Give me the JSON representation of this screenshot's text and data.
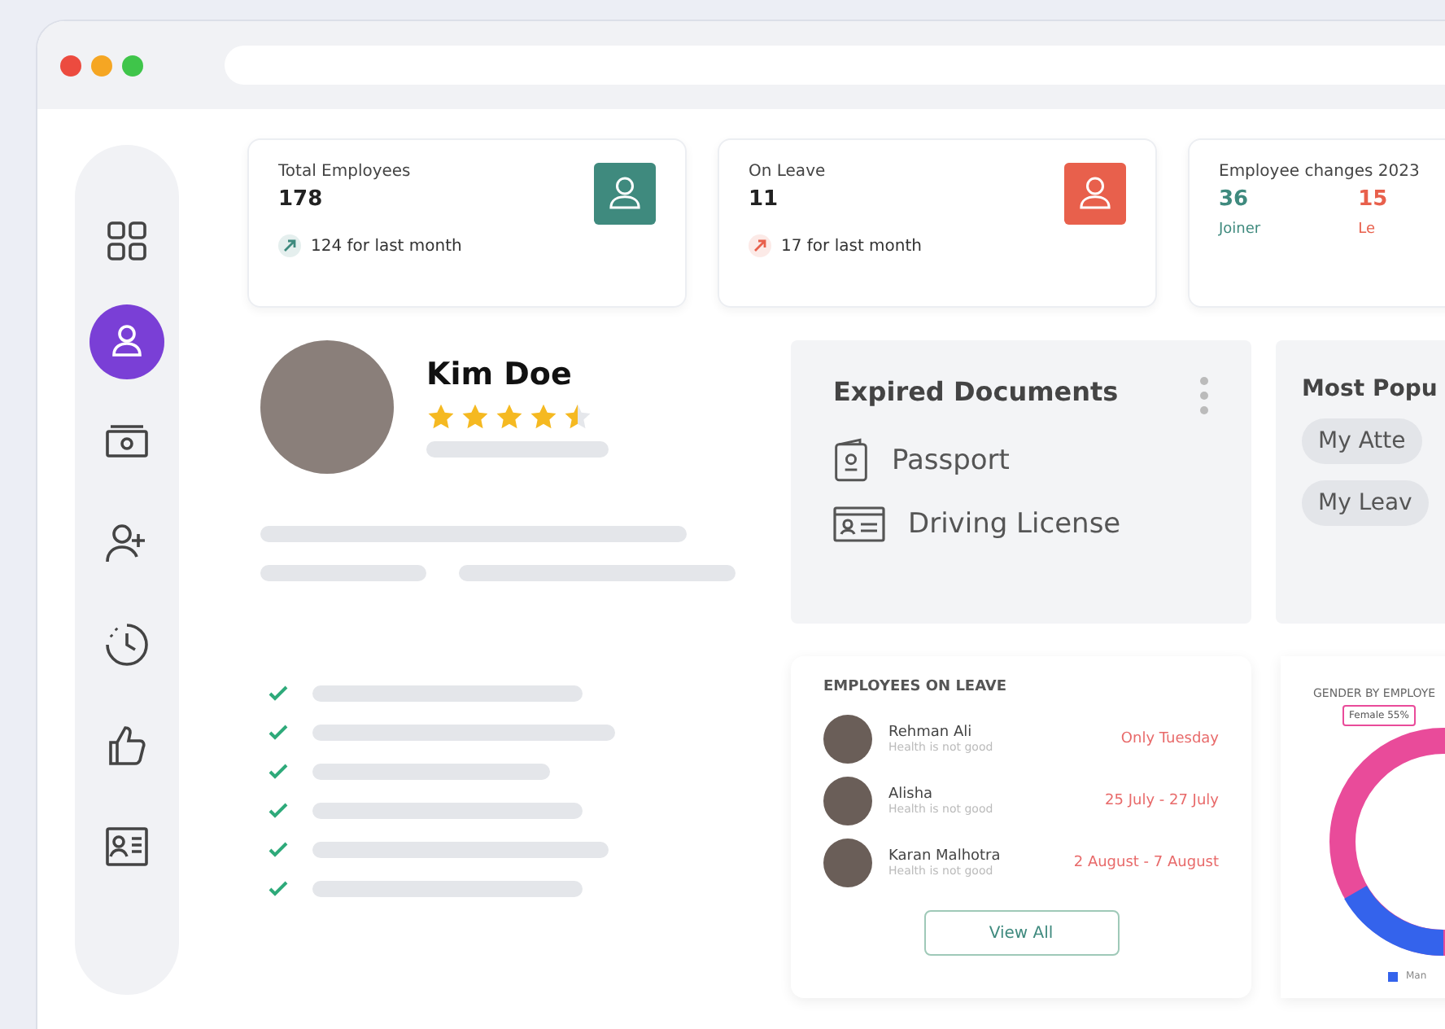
{
  "sidebar": {
    "items": [
      {
        "kind": "grid",
        "selected": false
      },
      {
        "kind": "user",
        "selected": true
      },
      {
        "kind": "money",
        "selected": false
      },
      {
        "kind": "add-user",
        "selected": false
      },
      {
        "kind": "clock",
        "selected": false
      },
      {
        "kind": "thumb",
        "selected": false
      },
      {
        "kind": "id-card",
        "selected": false
      }
    ]
  },
  "stats": [
    {
      "kind": "single",
      "title": "Total Employees",
      "value": "178",
      "note": "124 for last month",
      "color": "#3f8a7e"
    },
    {
      "kind": "single",
      "title": "On Leave",
      "value": "11",
      "note": "17 for last month",
      "color": "#e8604c"
    },
    {
      "kind": "split",
      "title": "Employee changes 2023",
      "parts": [
        {
          "value": "36",
          "label": "Joiner",
          "color": "#3f8a7e"
        },
        {
          "value": "15",
          "label": "Le",
          "color": "#e8604c"
        }
      ]
    }
  ],
  "profile": {
    "name": "Kim Doe",
    "stars": 4.5
  },
  "expired_documents": {
    "title": "Expired Documents",
    "items": [
      {
        "kind": "passport",
        "label": "Passport"
      },
      {
        "kind": "license",
        "label": "Driving License"
      }
    ]
  },
  "most_popular": {
    "title": "Most Popu",
    "items": [
      "My Atte",
      "My Leav"
    ]
  },
  "employees_on_leave": {
    "title": "EMPLOYEES ON LEAVE",
    "rows": [
      {
        "name": "Rehman Ali",
        "status": "Health is not good",
        "when": "Only Tuesday"
      },
      {
        "name": "Alisha",
        "status": "Health is not good",
        "when": "25 July - 27 July"
      },
      {
        "name": "Karan Malhotra",
        "status": "Health is not good",
        "when": "2 August - 7 August"
      }
    ],
    "button": "View All"
  },
  "gender_chart": {
    "title": "GENDER BY EMPLOYE",
    "label": "Female 55%",
    "legend": "Man"
  }
}
